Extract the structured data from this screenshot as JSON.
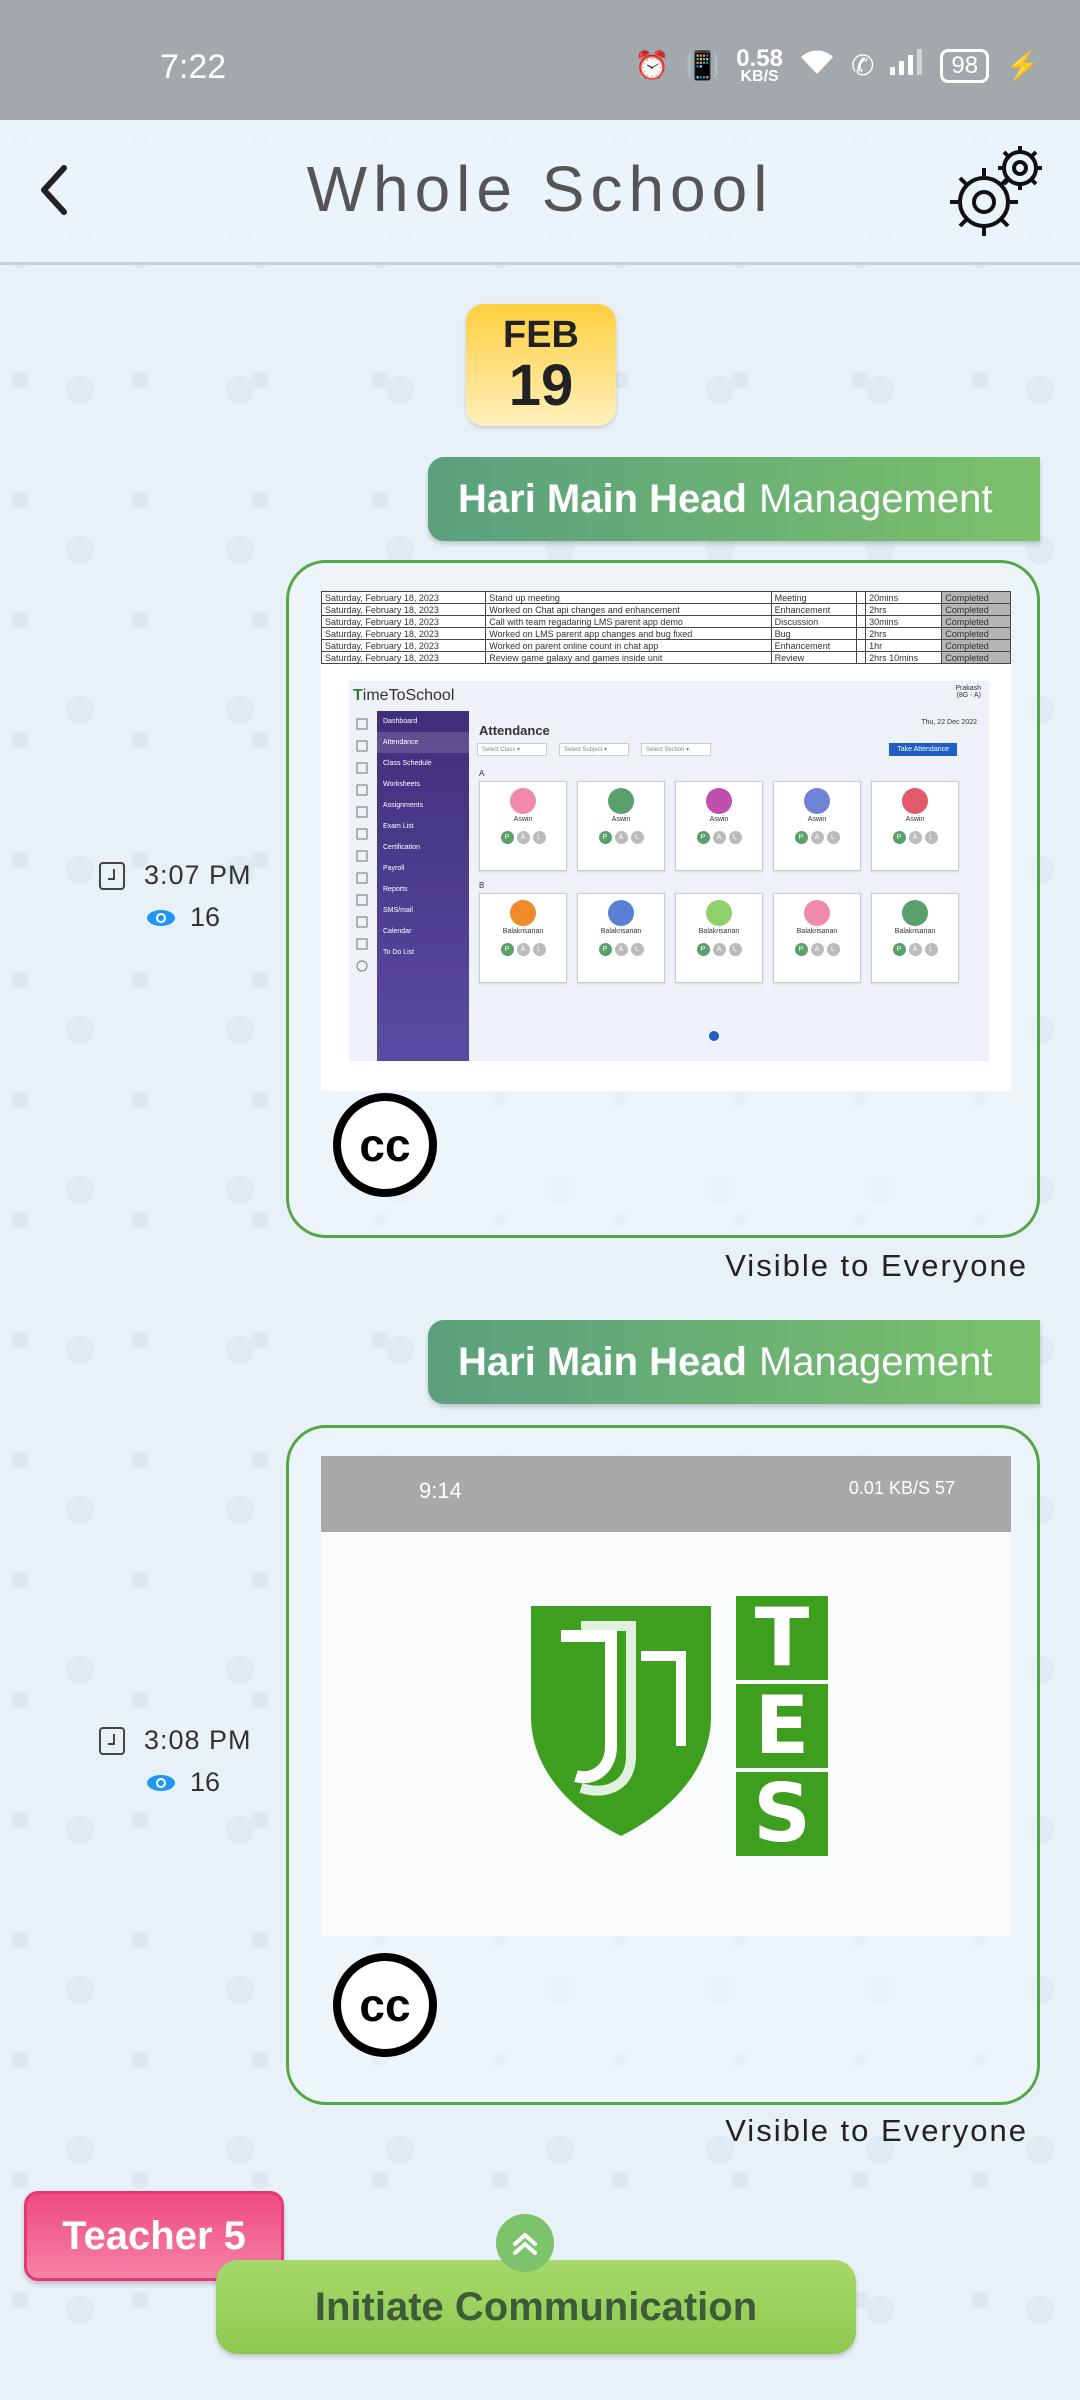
{
  "status_bar": {
    "time": "7:22",
    "net_speed_value": "0.58",
    "net_speed_unit": "KB/S",
    "battery": "98"
  },
  "header": {
    "title": "Whole School"
  },
  "date_chip": {
    "month": "FEB",
    "day": "19"
  },
  "messages": [
    {
      "sender_name": "Hari Main Head",
      "sender_role": "Management",
      "time": "3:07 PM",
      "views": "16",
      "visibility": "Visible to Everyone",
      "attachment": {
        "type": "screenshot",
        "table_rows": [
          [
            "Saturday, February 18, 2023",
            "Stand up meeting",
            "Meeting",
            "20mins",
            "Completed"
          ],
          [
            "Saturday, February 18, 2023",
            "Worked on Chat api changes and enhancement",
            "Enhancement",
            "2hrs",
            "Completed"
          ],
          [
            "Saturday, February 18, 2023",
            "Call with team regadaring LMS parent app demo",
            "Discussion",
            "30mins",
            "Completed"
          ],
          [
            "Saturday, February 18, 2023",
            "Worked on LMS parent app changes and bug fixed",
            "Bug",
            "2hrs",
            "Completed"
          ],
          [
            "Saturday, February 18, 2023",
            "Worked on parent online count in chat app",
            "Enhancement",
            "1hr",
            "Completed"
          ],
          [
            "Saturday, February 18, 2023",
            "Review game galaxy and games inside unit",
            "Review",
            "2hrs 10mins",
            "Completed"
          ]
        ],
        "app_logo_prefix": "T",
        "app_logo_rest": "imeToSchool",
        "page_heading": "Attendance",
        "date_label": "Thu, 22 Dec 2022",
        "take_attendance_label": "Take Attendance",
        "filters": [
          "Select Class",
          "Select Subject",
          "Select Section"
        ],
        "sidebar": [
          "Dashboard",
          "Attendance",
          "Class Schedule",
          "Worksheets",
          "Assignments",
          "Exam List",
          "Certification",
          "Payroll",
          "Reports",
          "SMS/mail",
          "Calendar",
          "To Do List"
        ],
        "user_name": "Prakash",
        "user_sub": "(8G - A)",
        "section_a_label": "A",
        "section_b_label": "B",
        "row_a_name": "Aswin",
        "row_b_name": "Balakrisanan",
        "pal_letters": [
          "P",
          "A",
          "L"
        ],
        "row_a_colors": [
          "#f08aa8",
          "#59a06a",
          "#c04fb0",
          "#6e82d6",
          "#e05a6a"
        ],
        "row_b_colors": [
          "#f08a2a",
          "#5a7fd6",
          "#8fd06a",
          "#f08aa8",
          "#59a06a"
        ]
      },
      "cc_label": "cc"
    },
    {
      "sender_name": "Hari Main Head",
      "sender_role": "Management",
      "time": "3:08 PM",
      "views": "16",
      "visibility": "Visible to Everyone",
      "attachment": {
        "type": "logo",
        "status_time": "9:14",
        "status_right": "0.01 KB/S  57",
        "logo_letters": [
          "T",
          "E",
          "S"
        ],
        "brand_color": "#3e9f1f"
      },
      "cc_label": "cc"
    }
  ],
  "footer": {
    "teacher_tag": "Teacher 5",
    "initiate_label": "Initiate Communication"
  }
}
